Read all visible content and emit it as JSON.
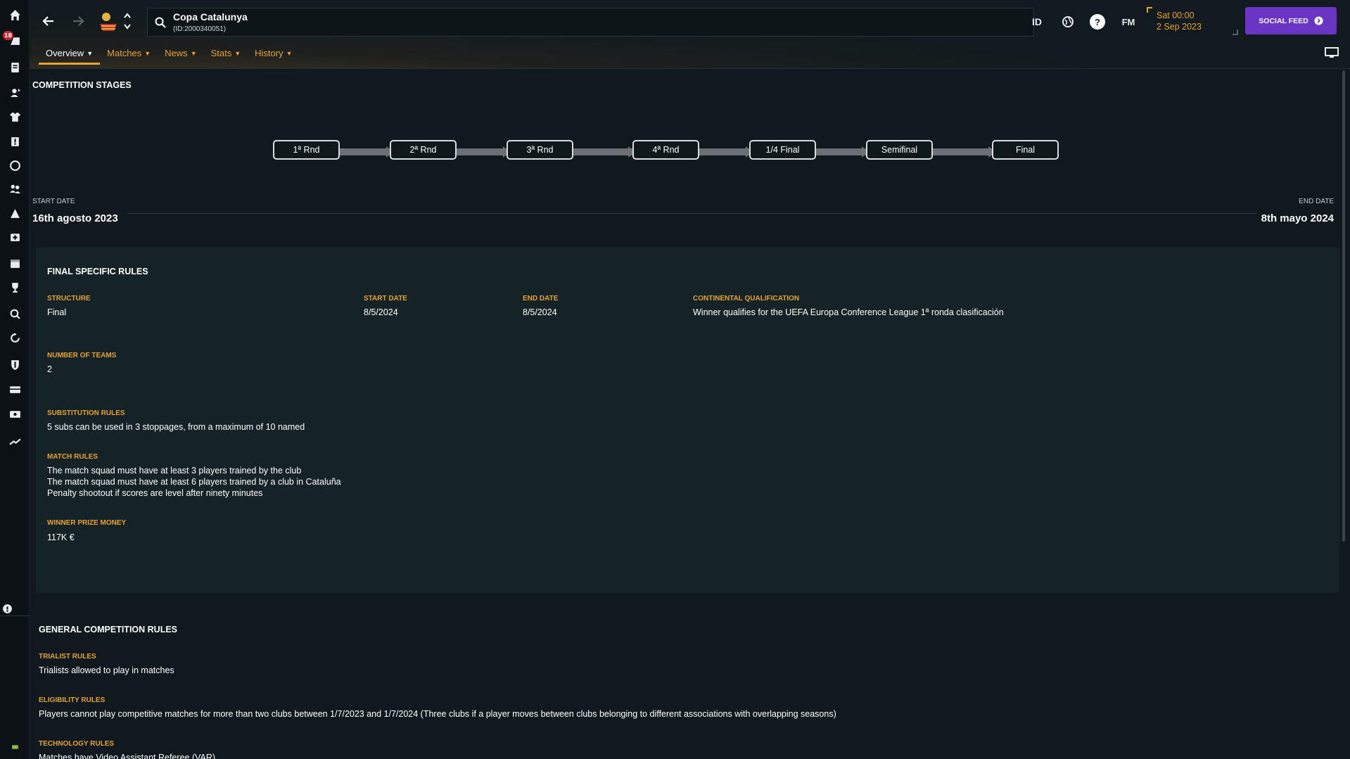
{
  "sidebar": {
    "badge_count": "18"
  },
  "search": {
    "title": "Copa Catalunya",
    "subtitle": "(ID:2000340051)"
  },
  "header_icons": {
    "id_label": "ID",
    "fm_label": "FM",
    "help_label": "?"
  },
  "datetime": {
    "line1": "Sat 00:00",
    "line2": "2 Sep 2023"
  },
  "social_feed": {
    "label": "SOCIAL FEED"
  },
  "tabs": [
    {
      "label": "Overview"
    },
    {
      "label": "Matches"
    },
    {
      "label": "News"
    },
    {
      "label": "Stats"
    },
    {
      "label": "History"
    }
  ],
  "competition_stages": {
    "title": "COMPETITION STAGES",
    "stages": [
      "1ª Rnd",
      "2ª Rnd",
      "3ª Rnd",
      "4ª Rnd",
      "1/4 Final",
      "Semifinal",
      "Final"
    ]
  },
  "dates": {
    "start_label": "START DATE",
    "start_value": "16th agosto 2023",
    "end_label": "END DATE",
    "end_value": "8th mayo 2024"
  },
  "final_rules": {
    "title": "FINAL SPECIFIC RULES",
    "structure_label": "STRUCTURE",
    "structure_value": "Final",
    "start_label": "START DATE",
    "start_value": "8/5/2024",
    "end_label": "END DATE",
    "end_value": "8/5/2024",
    "continental_label": "CONTINENTAL QUALIFICATION",
    "continental_value": "Winner qualifies for the UEFA Europa Conference League 1ª ronda clasificación",
    "teams_label": "NUMBER OF TEAMS",
    "teams_value": "2",
    "subs_label": "SUBSTITUTION RULES",
    "subs_value": "5 subs can be used in 3 stoppages, from a maximum of 10 named",
    "match_label": "MATCH RULES",
    "match_rules": [
      "The match squad must have at least 3 players trained by the club",
      "The match squad must have at least 6 players trained by a club in Cataluña",
      "Penalty shootout if scores are level after ninety minutes"
    ],
    "prize_label": "WINNER PRIZE MONEY",
    "prize_value": "117K €"
  },
  "general_rules": {
    "title": "GENERAL COMPETITION RULES",
    "trialist_label": "TRIALIST RULES",
    "trialist_value": "Trialists allowed to play in matches",
    "eligibility_label": "ELIGIBILITY RULES",
    "eligibility_value": "Players cannot play competitive matches for more than two clubs between 1/7/2023 and 1/7/2024 (Three clubs if a player moves between clubs belonging to different associations with overlapping seasons)",
    "technology_label": "TECHNOLOGY RULES",
    "technology_value": "Matches have Video Assistant Referee (VAR)"
  },
  "colors": {
    "accent": "#e7a32c",
    "social": "#6a35c4",
    "badge": "#c8262c"
  }
}
